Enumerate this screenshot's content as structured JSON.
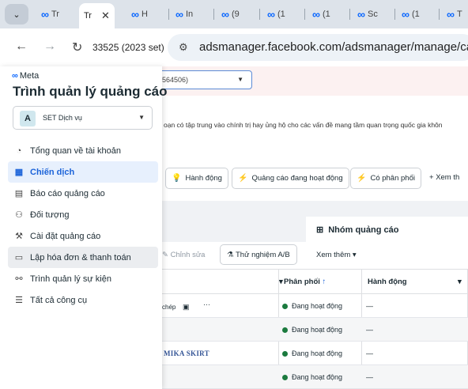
{
  "browser": {
    "tabs": [
      {
        "label": "Tr",
        "active": false
      },
      {
        "label": "Tr",
        "active": true
      },
      {
        "label": "H",
        "active": false
      },
      {
        "label": "In",
        "active": false
      },
      {
        "label": "(9",
        "active": false
      },
      {
        "label": "(1",
        "active": false
      },
      {
        "label": "(1",
        "active": false
      },
      {
        "label": "Sc",
        "active": false
      },
      {
        "label": "(1",
        "active": false
      },
      {
        "label": "T",
        "active": false
      }
    ],
    "tab_close": "✕",
    "profile_label": "33525 (2023 set)",
    "url": "adsmanager.facebook.com/adsmanager/manage/camp"
  },
  "sidebar": {
    "logo_text": "Meta",
    "title": "Trình quản lý quảng cáo",
    "account": {
      "avatar": "A",
      "name": "SET Dịch vụ"
    },
    "items": [
      {
        "label": "Tổng quan về tài khoản",
        "icon": "gauge-icon",
        "glyph": "◔"
      },
      {
        "label": "Chiến dịch",
        "icon": "table-icon",
        "glyph": "▦",
        "active": true
      },
      {
        "label": "Báo cáo quảng cáo",
        "icon": "report-icon",
        "glyph": "▤"
      },
      {
        "label": "Đối tượng",
        "icon": "audience-icon",
        "glyph": "⚇"
      },
      {
        "label": "Cài đặt quảng cáo",
        "icon": "settings-icon",
        "glyph": "⚒"
      },
      {
        "label": "Lập hóa đơn & thanh toán",
        "icon": "billing-icon",
        "glyph": "▭",
        "hover": true
      },
      {
        "label": "Trình quản lý sự kiện",
        "icon": "events-icon",
        "glyph": "⚯"
      },
      {
        "label": "Tất cả công cụ",
        "icon": "menu-icon",
        "glyph": "☰"
      }
    ]
  },
  "main": {
    "account_select": "564506)",
    "notice": "oạn có tập trung vào chính trị hay ủng hộ cho các vấn đề mang tầm quan trọng quốc gia khôn",
    "filters": [
      {
        "label": "Hành động",
        "glyph": "💡"
      },
      {
        "label": "Quảng cáo đang hoạt động",
        "glyph": "⚡"
      },
      {
        "label": "Có phân phối",
        "glyph": "⚡"
      }
    ],
    "filter_more": "Xem th",
    "adgroup_tab": "Nhóm quảng cáo",
    "toolbar": {
      "edit": "Chỉnh sửa",
      "ab_test": "Thử nghiệm A/B",
      "see_more": "Xem thêm"
    },
    "columns": {
      "delivery": "Phân phối",
      "action": "Hành động"
    },
    "rows": [
      {
        "name": "chép",
        "status": "Đang hoạt động",
        "action": "—"
      },
      {
        "name": "",
        "status": "Đang hoạt động",
        "action": "—"
      },
      {
        "name": "MIKA SKIRT",
        "status": "Đang hoạt động",
        "action": "—"
      },
      {
        "name": "",
        "status": "Đang hoạt động",
        "action": "—"
      }
    ]
  }
}
